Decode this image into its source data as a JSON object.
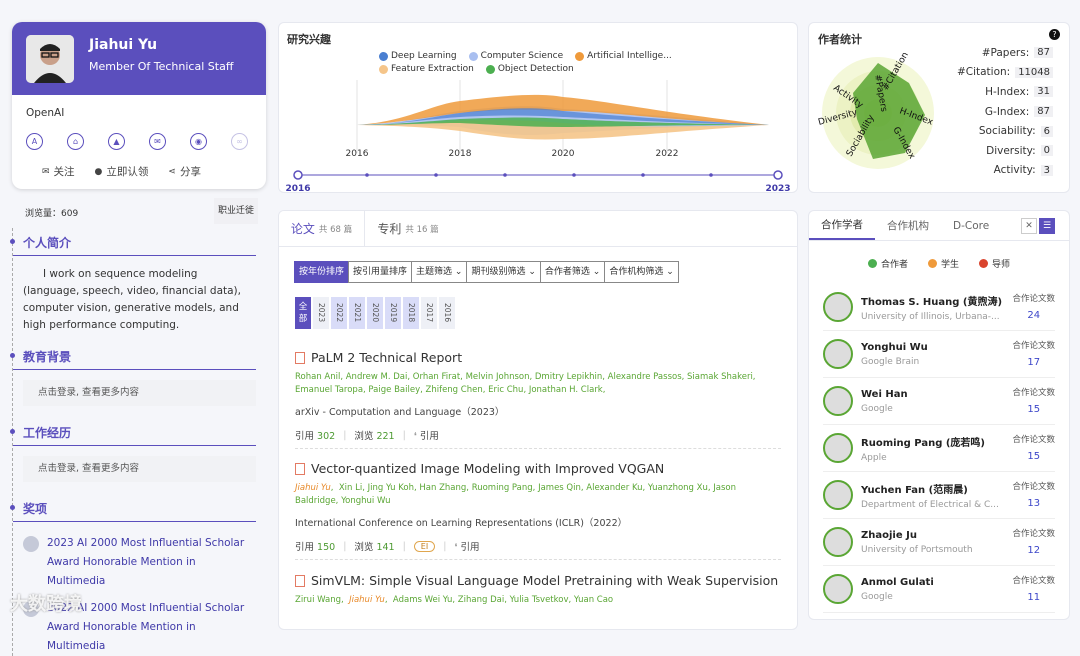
{
  "profile": {
    "name": "Jiahui Yu",
    "role": "Member Of Technical Staff",
    "org": "OpenAI",
    "actions": [
      {
        "label": "关注"
      },
      {
        "label": "立即认领"
      },
      {
        "label": "分享"
      }
    ],
    "views": "浏览量：609",
    "job_btn": "职业迁徙"
  },
  "left": {
    "bio_title": "个人简介",
    "bio": "I work on sequence modeling (language, speech, video, financial data), computer vision, generative models, and high performance computing.",
    "edu_title": "教育背景",
    "edu_login": "点击登录, 查看更多内容",
    "work_title": "工作经历",
    "work_login": "点击登录, 查看更多内容",
    "awards_title": "奖项",
    "awards": [
      "2023 AI 2000 Most Influential Scholar Award Honorable Mention in Multimedia",
      "2022 AI 2000 Most Influential Scholar Award Honorable Mention in Multimedia"
    ]
  },
  "research": {
    "title": "研究兴趣",
    "legend": [
      {
        "name": "Deep Learning",
        "color": "#4a7fd1"
      },
      {
        "name": "Computer Science",
        "color": "#a9bff0"
      },
      {
        "name": "Artificial Intellige...",
        "color": "#ef9a3b"
      },
      {
        "name": "Feature Extraction",
        "color": "#f5c58a"
      },
      {
        "name": "Object Detection",
        "color": "#4caf50"
      }
    ],
    "axis_years": [
      "2016",
      "2018",
      "2020",
      "2022"
    ],
    "range_start": "2016",
    "range_end": "2023"
  },
  "stats": {
    "title": "作者统计",
    "help": "?",
    "rows": [
      {
        "label": "#Papers:",
        "value": "87"
      },
      {
        "label": "#Citation:",
        "value": "11048"
      },
      {
        "label": "H-Index:",
        "value": "31"
      },
      {
        "label": "G-Index:",
        "value": "87"
      },
      {
        "label": "Sociability:",
        "value": "6"
      },
      {
        "label": "Diversity:",
        "value": "0"
      },
      {
        "label": "Activity:",
        "value": "3"
      }
    ],
    "radar_labels": [
      "#Papers",
      "#Citation",
      "H-Index",
      "G-Index",
      "Sociability",
      "Diversity",
      "Activity"
    ]
  },
  "papers": {
    "tab1": "论文",
    "tab1_count": "共 68 篇",
    "tab2": "专利",
    "tab2_count": "共 16 篇",
    "filters": [
      "按年份排序",
      "按引用量排序",
      "主题筛选",
      "期刊级别筛选",
      "合作者筛选",
      "合作机构筛选"
    ],
    "years_all": "全部",
    "years": [
      "2023",
      "2022",
      "2021",
      "2020",
      "2019",
      "2018",
      "2017",
      "2016"
    ],
    "items": [
      {
        "title": "PaLM 2 Technical Report",
        "authors": "Rohan Anil,  Andrew M. Dai,  Orhan Firat,  Melvin Johnson,  Dmitry Lepikhin,  Alexandre Passos,  Siamak Shakeri,  Emanuel Taropa,  Paige Bailey,  Zhifeng Chen,  Eric Chu,  Jonathan H. Clark,",
        "venue": "arXiv - Computation and Language（2023）",
        "cite_label": "引用",
        "cite": "302",
        "view_label": "浏览",
        "view": "221",
        "quote": "引用"
      },
      {
        "title": "Vector-quantized Image Modeling with Improved VQGAN",
        "author_me": "Jiahui Yu",
        "authors": "Xin Li,  Jing Yu Koh,  Han Zhang,  Ruoming Pang,  James Qin,  Alexander Ku,  Yuanzhong Xu,  Jason Baldridge,  Yonghui Wu",
        "venue": "International Conference on Learning Representations (ICLR)（2022）",
        "cite_label": "引用",
        "cite": "150",
        "view_label": "浏览",
        "view": "141",
        "badge": "EI",
        "quote": "引用"
      },
      {
        "title": "SimVLM: Simple Visual Language Model Pretraining with Weak Supervision",
        "authors_pre": "Zirui Wang,",
        "author_me": "Jiahui Yu",
        "authors": "Adams Wei Yu,  Zihang Dai,  Yulia Tsvetkov,  Yuan Cao"
      }
    ]
  },
  "coauthors": {
    "tabs": [
      "合作学者",
      "合作机构",
      "D-Core"
    ],
    "legend": [
      {
        "name": "合作者",
        "color": "#4caf50"
      },
      {
        "name": "学生",
        "color": "#ef9a3b"
      },
      {
        "name": "导师",
        "color": "#d9442e"
      }
    ],
    "count_label": "合作论文数",
    "items": [
      {
        "name": "Thomas S. Huang (黄煦涛)",
        "aff": "University of Illinois, Urbana-...",
        "count": "24"
      },
      {
        "name": "Yonghui Wu",
        "aff": "Google Brain",
        "count": "17"
      },
      {
        "name": "Wei Han",
        "aff": "Google",
        "count": "15"
      },
      {
        "name": "Ruoming Pang (庞若鸣)",
        "aff": "Apple",
        "count": "15"
      },
      {
        "name": "Yuchen Fan (范雨晨)",
        "aff": "Department of Electrical & C...",
        "count": "13"
      },
      {
        "name": "Zhaojie Ju",
        "aff": "University of Portsmouth",
        "count": "12"
      },
      {
        "name": "Anmol Gulati",
        "aff": "Google",
        "count": "11"
      }
    ]
  },
  "watermark": "大数跨境"
}
